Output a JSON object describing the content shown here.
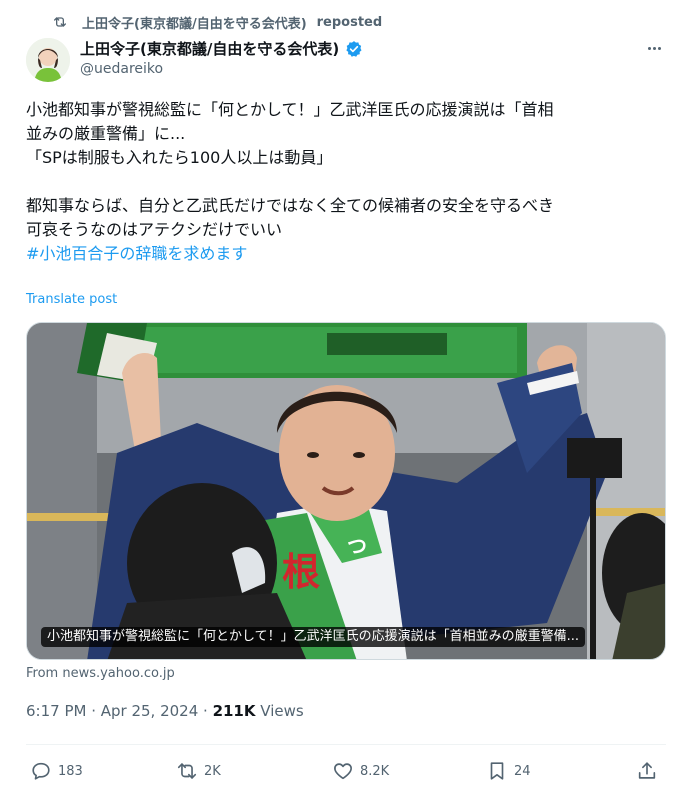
{
  "repost": {
    "reposter": "上田令子(東京都議/自由を守る会代表)",
    "label": "reposted"
  },
  "author": {
    "name": "上田令子(東京都議/自由を守る会代表)",
    "handle": "@uedareiko"
  },
  "post": {
    "lines": [
      "小池都知事が警視総監に「何とかして！」乙武洋匡氏の応援演説は「首相",
      "並みの厳重警備」に...",
      "「SPは制服も入れたら100人以上は動員」",
      "",
      "都知事ならば、自分と乙武氏だけではなく全ての候補者の安全を守るべき",
      "可哀そうなのはアテクシだけでいい"
    ],
    "hashtag": "#小池百合子の辞職を求めます",
    "translate": "Translate post"
  },
  "card": {
    "caption": "小池都知事が警視総監に「何とかして！」乙武洋匡氏の応援演説は「首相並みの厳重警備...",
    "source": "From news.yahoo.co.jp"
  },
  "meta": {
    "time": "6:17 PM · Apr 25, 2024 · ",
    "views_count": "211K",
    "views_label": " Views"
  },
  "actions": {
    "replies": "183",
    "reposts": "2K",
    "likes": "8.2K",
    "bookmarks": "24"
  },
  "colors": {
    "accent": "#1d9bf0",
    "text": "#0f1419",
    "muted": "#536471",
    "border": "#cfd9de"
  },
  "icons": [
    "repost-icon",
    "verified-badge-icon",
    "more-icon",
    "reply-icon",
    "retweet-icon",
    "like-icon",
    "bookmark-icon",
    "share-icon"
  ]
}
